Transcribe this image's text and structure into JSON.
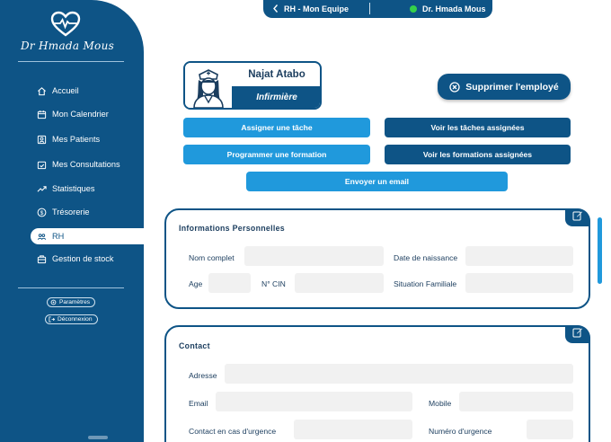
{
  "sidebar": {
    "brand": "Dr Hmada Mous",
    "items": [
      {
        "label": "Accueil",
        "icon": "home-icon"
      },
      {
        "label": "Mon Calendrier",
        "icon": "calendar-icon"
      },
      {
        "label": "Mes Patients",
        "icon": "patients-icon"
      },
      {
        "label": "Mes Consultations",
        "icon": "consultations-icon"
      },
      {
        "label": "Statistiques",
        "icon": "trend-icon"
      },
      {
        "label": "Trésorerie",
        "icon": "dollar-icon"
      },
      {
        "label": "RH",
        "icon": "team-icon",
        "active": true
      },
      {
        "label": "Gestion de stock",
        "icon": "box-icon"
      }
    ],
    "settings_label": "Paramètres",
    "logout_label": "Déconnexion"
  },
  "topbar": {
    "title": "RH - Mon Equipe",
    "user": "Dr. Hmada Mous",
    "status_color": "#35d14a"
  },
  "employee": {
    "name": "Najat Atabo",
    "role": "Infirmière"
  },
  "actions": {
    "delete_label": "Supprimer l'employé",
    "assign_task": "Assigner une tâche",
    "view_tasks": "Voir les tâches assignées",
    "schedule_training": "Programmer une formation",
    "view_trainings": "Voir les formations assignées",
    "send_email": "Envoyer un email"
  },
  "personal": {
    "title": "Informations Personnelles",
    "full_name_label": "Nom complet",
    "full_name": "",
    "birth_date_label": "Date de naissance",
    "birth_date": "",
    "age_label": "Age",
    "age": "",
    "cin_label": "N° CIN",
    "cin": "",
    "family_label": "Situation Familiale",
    "family": ""
  },
  "contact": {
    "title": "Contact",
    "address_label": "Adresse",
    "address": "",
    "email_label": "Email",
    "email": "",
    "mobile_label": "Mobile",
    "mobile": "",
    "emergency_label": "Contact en cas d'urgence",
    "emergency": "",
    "emergency_number_label": "Numéro d'urgence",
    "emergency_number": ""
  },
  "colors": {
    "primary": "#0e5486",
    "accent": "#2099dc",
    "field": "#f1f1f1"
  }
}
